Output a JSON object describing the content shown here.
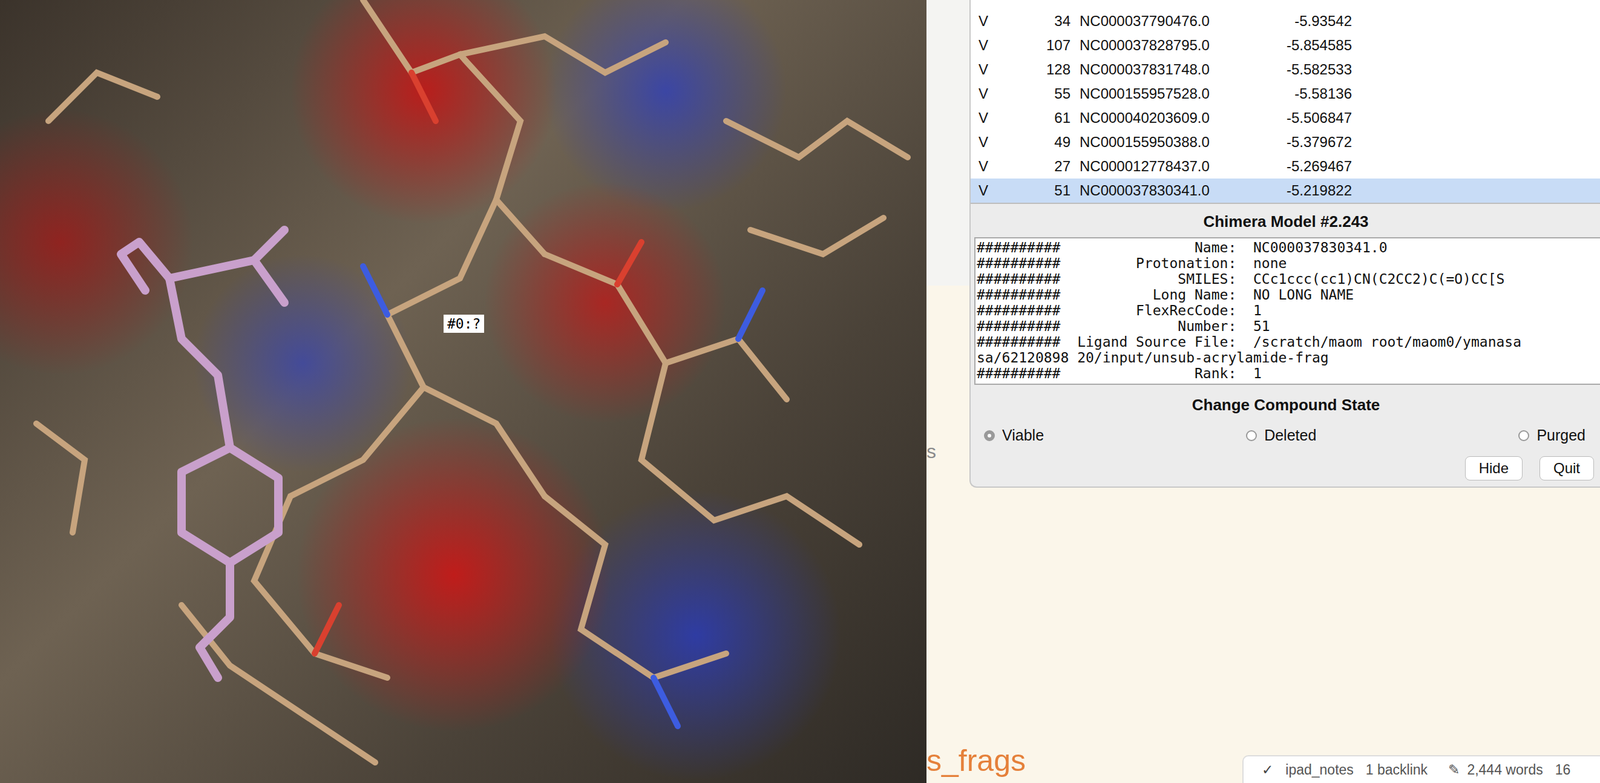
{
  "viewport": {
    "label": "#0:?"
  },
  "table": {
    "rows": [
      {
        "state": "V",
        "number": "34",
        "name": "NC000037790476.0",
        "score": "-5.93542",
        "selected": false
      },
      {
        "state": "V",
        "number": "107",
        "name": "NC000037828795.0",
        "score": "-5.854585",
        "selected": false
      },
      {
        "state": "V",
        "number": "128",
        "name": "NC000037831748.0",
        "score": "-5.582533",
        "selected": false
      },
      {
        "state": "V",
        "number": "55",
        "name": "NC000155957528.0",
        "score": "-5.58136",
        "selected": false
      },
      {
        "state": "V",
        "number": "61",
        "name": "NC000040203609.0",
        "score": "-5.506847",
        "selected": false
      },
      {
        "state": "V",
        "number": "49",
        "name": "NC000155950388.0",
        "score": "-5.379672",
        "selected": false
      },
      {
        "state": "V",
        "number": "27",
        "name": "NC000012778437.0",
        "score": "-5.269467",
        "selected": false
      },
      {
        "state": "V",
        "number": "51",
        "name": "NC000037830341.0",
        "score": "-5.219822",
        "selected": true
      }
    ]
  },
  "model": {
    "title": "Chimera Model #2.243",
    "fields": [
      {
        "prefix": "##########",
        "label": "Name:",
        "value": "NC000037830341.0"
      },
      {
        "prefix": "##########",
        "label": "Protonation:",
        "value": "none"
      },
      {
        "prefix": "##########",
        "label": "SMILES:",
        "value": "CCc1ccc(cc1)CN(C2CC2)C(=O)CC[S"
      },
      {
        "prefix": "##########",
        "label": "Long Name:",
        "value": "NO_LONG_NAME"
      },
      {
        "prefix": "##########",
        "label": "FlexRecCode:",
        "value": "1"
      },
      {
        "prefix": "##########",
        "label": "Number:",
        "value": "51"
      },
      {
        "prefix": "##########",
        "label": "Ligand Source File:",
        "value": "/scratch/maom_root/maom0/ymanasa",
        "continuation": "sa/62120898_20/input/unsub-acrylamide-frag"
      },
      {
        "prefix": "##########",
        "label": "Rank:",
        "value": "1"
      }
    ]
  },
  "state": {
    "title": "Change Compound State",
    "options": [
      {
        "label": "Viable",
        "selected": true
      },
      {
        "label": "Deleted",
        "selected": false
      },
      {
        "label": "Purged",
        "selected": false
      }
    ]
  },
  "buttons": [
    "Hide",
    "Quit"
  ],
  "notes": {
    "fragment": "s",
    "title": "s_frags",
    "status": {
      "check": "✓",
      "vault": "ipad_notes",
      "backlinks": "1 backlink",
      "edit_icon": "✎",
      "words": "2,444 words",
      "extra": "16"
    }
  }
}
